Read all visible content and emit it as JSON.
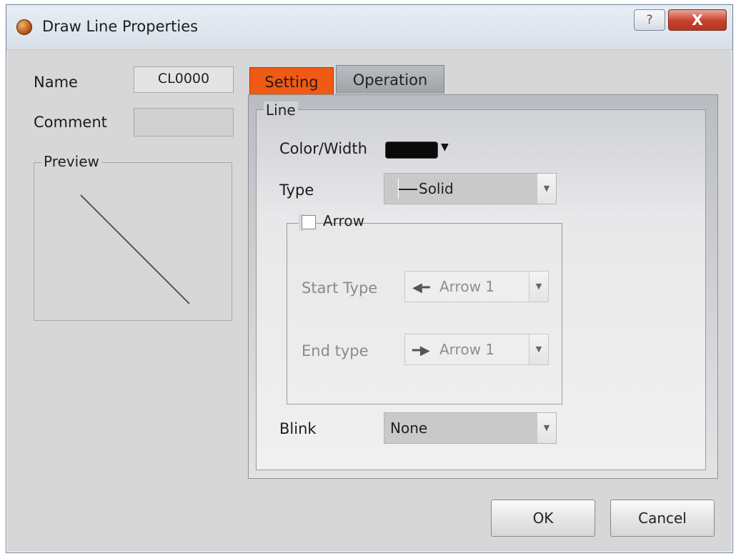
{
  "window": {
    "title": "Draw Line Properties",
    "help_glyph": "?",
    "close_glyph": "X"
  },
  "left": {
    "name_label": "Name",
    "name_value": "CL0000",
    "comment_label": "Comment",
    "comment_value": "",
    "preview_label": "Preview"
  },
  "tabs": [
    {
      "label": "Setting",
      "active": true
    },
    {
      "label": "Operation",
      "active": false
    }
  ],
  "setting": {
    "line_group": "Line",
    "color_width_label": "Color/Width",
    "line_color": "#0a0a0a",
    "type_label": "Type",
    "type_value": "Solid",
    "arrow_label": "Arrow",
    "arrow_checked": false,
    "start_type_label": "Start Type",
    "start_type_value": "Arrow 1",
    "end_type_label": "End type",
    "end_type_value": "Arrow 1",
    "blink_label": "Blink",
    "blink_value": "None"
  },
  "buttons": {
    "ok": "OK",
    "cancel": "Cancel"
  },
  "colors": {
    "active_tab": "#ef5a15",
    "close_button": "#c8412c"
  }
}
